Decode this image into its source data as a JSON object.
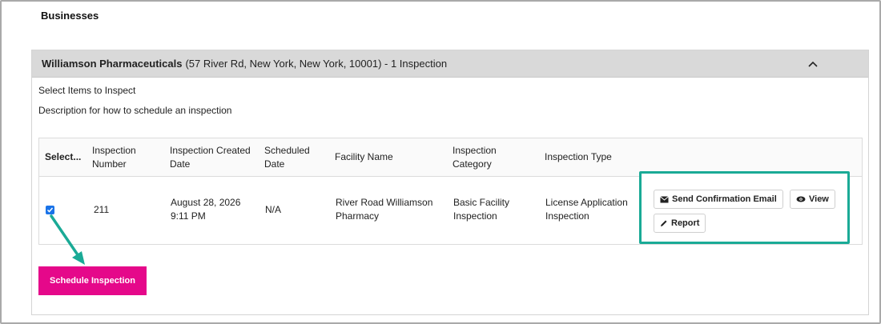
{
  "page": {
    "section_title": "Businesses"
  },
  "business": {
    "name": "Williamson Pharmaceuticals",
    "details": "(57 River Rd, New York, New York, 10001) - 1 Inspection",
    "select_items_text": "Select Items to Inspect",
    "description_text": "Description for how to schedule an inspection"
  },
  "table": {
    "headers": {
      "select": "Select...",
      "inspection_number": "Inspection Number",
      "created_date": "Inspection Created Date",
      "scheduled_date": "Scheduled Date",
      "facility_name": "Facility Name",
      "category": "Inspection Category",
      "type": "Inspection Type"
    },
    "rows": [
      {
        "selected": true,
        "inspection_number": "211",
        "created_date_line1": "August 28, 2026",
        "created_date_line2": "9:11 PM",
        "scheduled_date": "N/A",
        "facility_line1": "River Road Williamson",
        "facility_line2": "Pharmacy",
        "category_line1": "Basic Facility",
        "category_line2": "Inspection",
        "type_line1": "License Application",
        "type_line2": "Inspection"
      }
    ]
  },
  "actions": {
    "send_email_label": "Send Confirmation Email",
    "view_label": "View",
    "report_label": "Report"
  },
  "schedule_button_label": "Schedule Inspection",
  "colors": {
    "accent_pink": "#e5088a",
    "highlight_teal": "#1aaa96",
    "header_gray": "#d9d9d9",
    "checkbox_blue": "#1a73e8"
  }
}
